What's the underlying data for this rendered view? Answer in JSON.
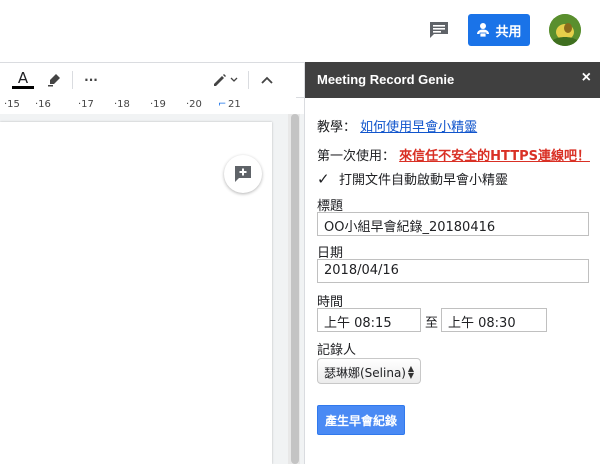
{
  "header": {
    "share_label": "共用",
    "comment_icon": "comment-icon",
    "avatar_icon": "avatar"
  },
  "toolbar": {
    "text_color_glyph": "A",
    "more_glyph": "···"
  },
  "ruler": {
    "ticks": [
      "·15",
      "·16",
      "·17",
      "·18",
      "·19",
      "·20",
      "21"
    ]
  },
  "panel": {
    "title": "Meeting Record Genie",
    "close_glyph": "×",
    "tutorial_label": "教學：",
    "tutorial_link": "如何使用早會小精靈",
    "first_use_label": "第一次使用：",
    "first_use_link": "來信任不安全的HTTPS連線吧！",
    "auto_start_label": "打開文件自動啟動早會小精靈",
    "auto_start_checked": true,
    "title_label": "標題",
    "title_value": "OO小組早會紀錄_20180416",
    "date_label": "日期",
    "date_value": "2018/04/16",
    "time_label": "時間",
    "time_start": "上午 08:15",
    "time_to": "至",
    "time_end": "上午 08:30",
    "recorder_label": "記錄人",
    "recorder_value": "瑟琳娜(Selina)",
    "generate_button": "產生早會紀錄"
  },
  "colors": {
    "accent": "#1a73e8",
    "panel_header": "#404040",
    "warning": "#d93025",
    "link": "#1155cc",
    "button": "#4a8af4"
  }
}
